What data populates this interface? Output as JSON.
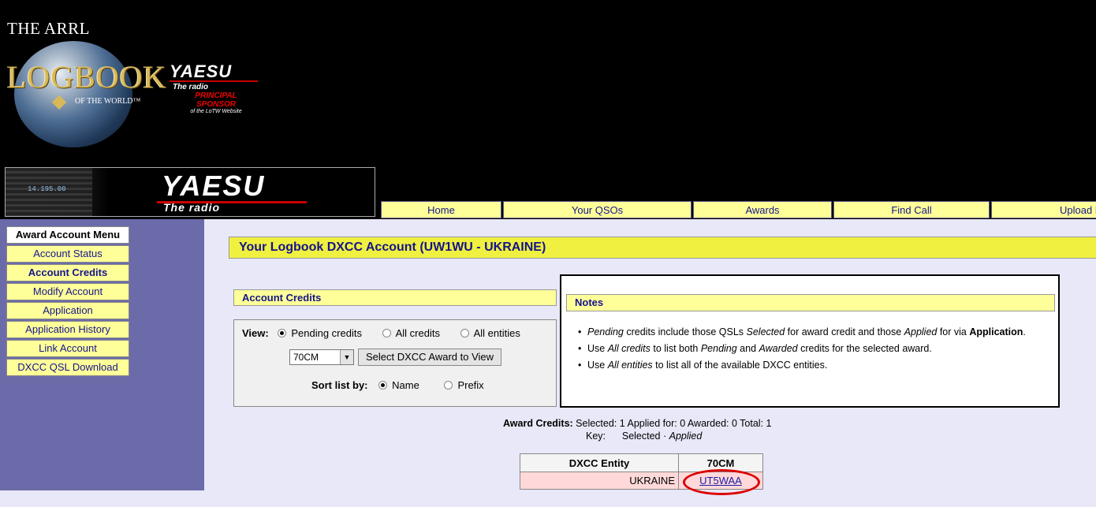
{
  "header": {
    "logo_arrl": "THE ARRL",
    "logo_logbook": "LOGBOOK",
    "logo_otw": "OF THE WORLD™",
    "sponsor": {
      "brand": "YAESU",
      "tagline": "The radio",
      "line1": "PRINCIPAL",
      "line2": "SPONSOR",
      "line3": "of the LoTW Website"
    },
    "banner": {
      "brand": "YAESU",
      "tagline": "The radio",
      "radio_display": "14.195.00"
    }
  },
  "topnav": [
    "Home",
    "Your QSOs",
    "Awards",
    "Find Call",
    "Upload F"
  ],
  "sidebar": {
    "title": "Award Account Menu",
    "items": [
      "Account Status",
      "Account Credits",
      "Modify Account",
      "Application",
      "Application History",
      "Link Account",
      "DXCC QSL Download"
    ]
  },
  "page_title": "Your Logbook DXCC Account (UW1WU - UKRAINE)",
  "credits_panel": {
    "title": "Account Credits",
    "view_label": "View:",
    "view_options": [
      "Pending credits",
      "All credits",
      "All entities"
    ],
    "award_select": "70CM",
    "select_button": "Select DXCC Award to View",
    "sort_label": "Sort list by:",
    "sort_options": [
      "Name",
      "Prefix"
    ]
  },
  "notes": {
    "title": "Notes",
    "n1": {
      "a": "Pending",
      "b": " credits include those QSLs ",
      "c": "Selected",
      "d": " for award credit and those ",
      "e": "Applied",
      "f": " for via ",
      "g": "Application",
      "h": "."
    },
    "n2": {
      "a": "Use ",
      "b": "All credits",
      "c": " to list both ",
      "d": "Pending",
      "e": " and ",
      "f": "Awarded",
      "g": " credits for the selected award."
    },
    "n3": {
      "a": "Use ",
      "b": "All entities",
      "c": " to list all of the available DXCC entities."
    }
  },
  "award_credits": {
    "label": "Award Credits:",
    "text": " Selected: 1 Applied for: 0 Awarded: 0 Total: 1",
    "key_label": "Key:",
    "key_selected": "Selected",
    "key_sep": " · ",
    "key_applied": "Applied"
  },
  "table": {
    "headers": [
      "DXCC Entity",
      "70CM"
    ],
    "rows": [
      {
        "entity": "UKRAINE",
        "call": "UT5WAA"
      }
    ]
  },
  "colors": {
    "nav_yellow": "#ffff99",
    "title_yellow": "#f0f040",
    "sidebar_purple": "#6b6baa",
    "link_blue": "#14148c",
    "selected_row": "#ffd9d9",
    "highlight_circle": "#dd0000"
  }
}
